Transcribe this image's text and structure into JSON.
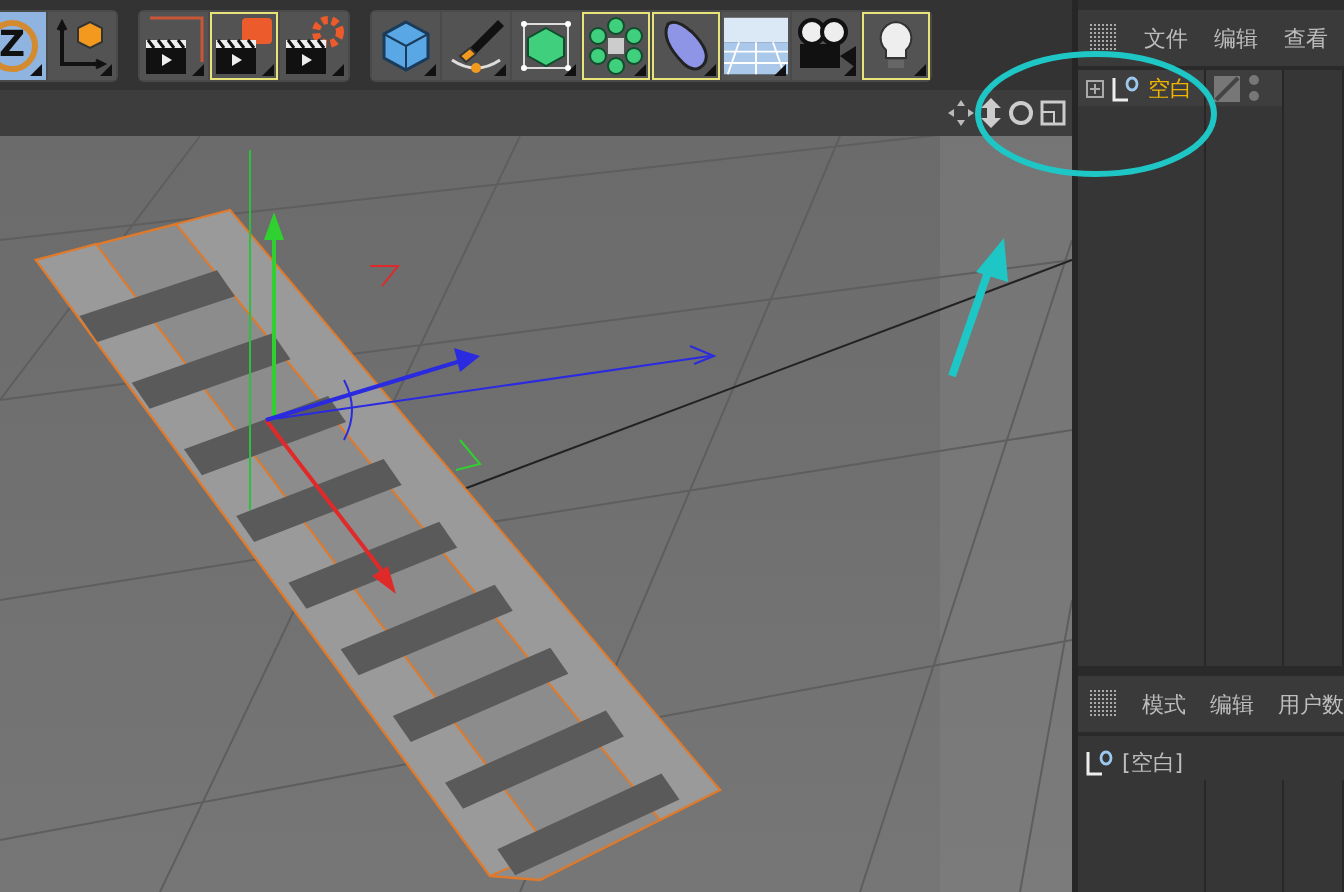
{
  "toolbar": {
    "groups": [
      {
        "buttons": [
          {
            "kind": "letter",
            "label": "Z",
            "selected": true
          },
          {
            "kind": "icon",
            "selected": false
          }
        ]
      },
      {
        "buttons": [
          {
            "kind": "icon",
            "selected": false
          },
          {
            "kind": "icon",
            "selected": true
          },
          {
            "kind": "icon",
            "selected": false
          }
        ]
      },
      {
        "buttons": [
          {
            "kind": "icon",
            "selected": false
          },
          {
            "kind": "icon",
            "selected": false
          },
          {
            "kind": "icon",
            "selected": false
          },
          {
            "kind": "icon",
            "selected": true
          },
          {
            "kind": "icon",
            "selected": true
          },
          {
            "kind": "icon",
            "selected": false
          },
          {
            "kind": "icon",
            "selected": false
          },
          {
            "kind": "icon",
            "selected": true
          }
        ]
      }
    ]
  },
  "object_manager": {
    "menu": [
      "文件",
      "编辑",
      "查看"
    ],
    "objects": [
      {
        "name": "空白",
        "selected": true
      }
    ]
  },
  "attribute_manager": {
    "menu": [
      "模式",
      "编辑",
      "用户数"
    ],
    "title": "[空白]"
  }
}
